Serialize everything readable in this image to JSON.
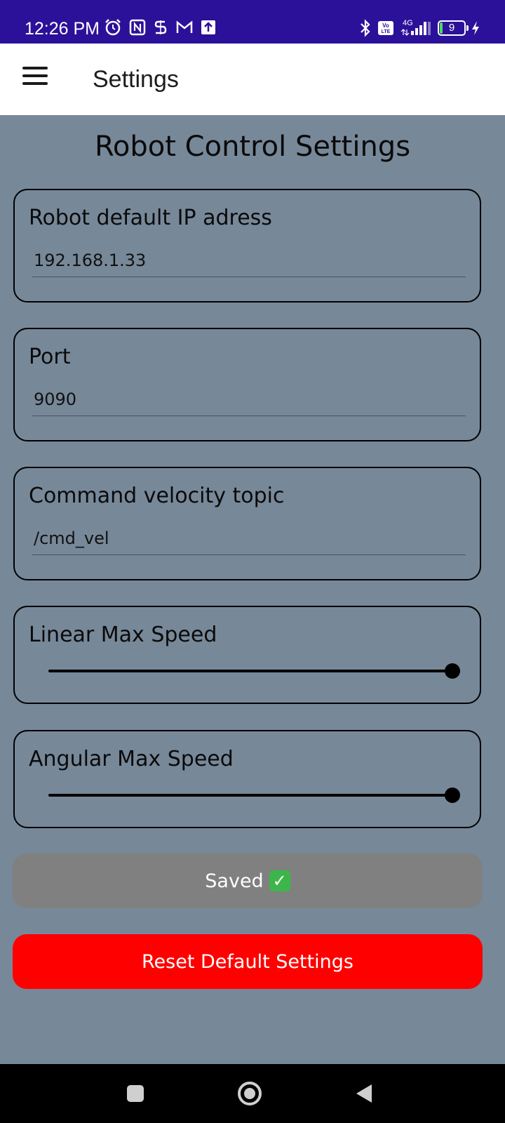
{
  "status_bar": {
    "time": "12:26 PM",
    "left_icons": [
      "alarm-icon",
      "nfc-icon",
      "s-app-icon",
      "gmail-icon",
      "upload-icon"
    ],
    "right_icons": [
      "bluetooth-icon",
      "volte-icon",
      "signal-icon"
    ],
    "network": "4G",
    "battery_level": "9"
  },
  "app_bar": {
    "menu_icon": "hamburger-menu-icon",
    "title": "Settings"
  },
  "page": {
    "heading": "Robot Control Settings",
    "fields": [
      {
        "label": "Robot default IP adress",
        "value": "192.168.1.33"
      },
      {
        "label": "Port",
        "value": "9090"
      },
      {
        "label": "Command velocity topic",
        "value": "/cmd_vel"
      }
    ],
    "sliders": [
      {
        "label": "Linear Max Speed",
        "value_fraction": 1.0
      },
      {
        "label": "Angular Max Speed",
        "value_fraction": 1.0
      }
    ],
    "saved_button": {
      "label": "Saved",
      "icon": "check-mark-icon",
      "color": "#808080"
    },
    "reset_button": {
      "label": "Reset Default Settings",
      "color": "#ff0000"
    }
  },
  "nav_bar": {
    "icons": [
      "recent-apps-icon",
      "home-icon",
      "back-icon"
    ]
  },
  "colors": {
    "status_bar": "#2b1199",
    "background": "#778899",
    "app_bar": "#ffffff"
  }
}
